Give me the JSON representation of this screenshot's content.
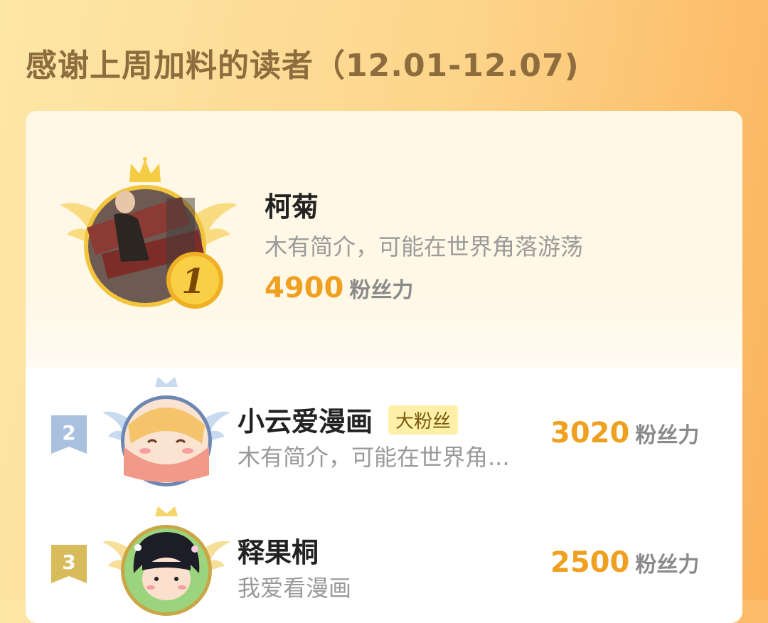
{
  "title": "感谢上周加料的读者（12.01-12.07)",
  "unit_label": "粉丝力",
  "colors": {
    "accent": "#f0a020",
    "gold": "#f4c23c",
    "silver": "#9fb6d6",
    "bronze": "#d4b24a"
  },
  "readers": [
    {
      "rank": "1",
      "name": "柯菊",
      "bio": "木有简介，可能在世界角落游荡",
      "score": "4900"
    },
    {
      "rank": "2",
      "name": "小云爱漫画",
      "badge": "大粉丝",
      "bio": "木有简介，可能在世界角...",
      "score": "3020"
    },
    {
      "rank": "3",
      "name": "释果桐",
      "bio": "我爱看漫画",
      "score": "2500"
    }
  ]
}
